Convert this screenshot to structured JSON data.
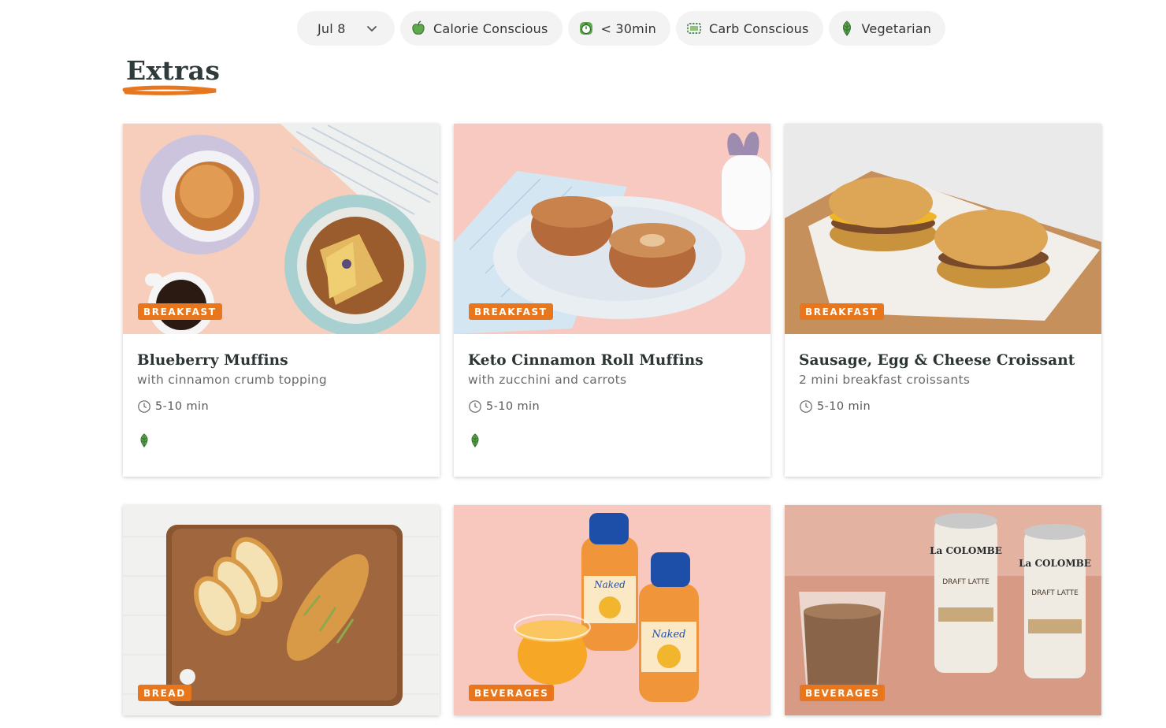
{
  "filters": {
    "date": {
      "label": "Jul 8",
      "icon": "chevron-down-icon"
    },
    "tags": [
      {
        "label": "Calorie Conscious",
        "icon": "apple-icon"
      },
      {
        "label": "< 30min",
        "icon": "stopwatch-icon"
      },
      {
        "label": "Carb Conscious",
        "icon": "bread-icon"
      },
      {
        "label": "Vegetarian",
        "icon": "leaf-icon"
      }
    ]
  },
  "section": {
    "title": "Extras"
  },
  "colors": {
    "accent": "#e8761d",
    "leaf": "#3d8b4a",
    "pill_bg": "#f3f3f3"
  },
  "cards": [
    {
      "badge": "BREAKFAST",
      "name": "Blueberry Muffins",
      "description": "with cinnamon crumb topping",
      "time": "5-10 min",
      "vegetarian": true,
      "image": "muffins-on-plates-photo"
    },
    {
      "badge": "BREAKFAST",
      "name": "Keto Cinnamon Roll Muffins",
      "description": "with zucchini and carrots",
      "time": "5-10 min",
      "vegetarian": true,
      "image": "cinnamon-muffins-photo"
    },
    {
      "badge": "BREAKFAST",
      "name": "Sausage, Egg & Cheese Croissant",
      "description": "2 mini breakfast croissants",
      "time": "5-10 min",
      "vegetarian": false,
      "image": "croissant-sandwich-photo"
    },
    {
      "badge": "BREAD",
      "image": "garlic-bread-photo"
    },
    {
      "badge": "BEVERAGES",
      "image": "juice-bottles-photo",
      "bottle_brand": "Naked"
    },
    {
      "badge": "BEVERAGES",
      "image": "latte-cans-photo",
      "can_brand": "La COLOMBE",
      "can_product": "DRAFT LATTE"
    }
  ]
}
